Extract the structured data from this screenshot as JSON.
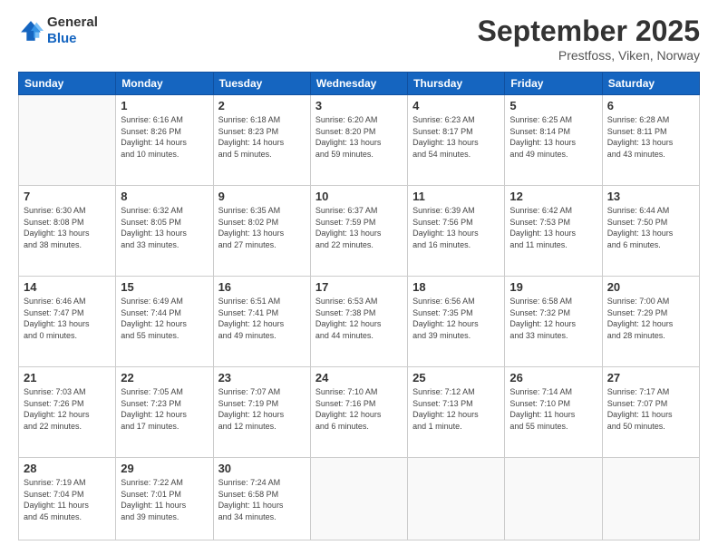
{
  "header": {
    "logo_line1": "General",
    "logo_line2": "Blue",
    "month": "September 2025",
    "location": "Prestfoss, Viken, Norway"
  },
  "weekdays": [
    "Sunday",
    "Monday",
    "Tuesday",
    "Wednesday",
    "Thursday",
    "Friday",
    "Saturday"
  ],
  "weeks": [
    [
      {
        "day": "",
        "info": ""
      },
      {
        "day": "1",
        "info": "Sunrise: 6:16 AM\nSunset: 8:26 PM\nDaylight: 14 hours\nand 10 minutes."
      },
      {
        "day": "2",
        "info": "Sunrise: 6:18 AM\nSunset: 8:23 PM\nDaylight: 14 hours\nand 5 minutes."
      },
      {
        "day": "3",
        "info": "Sunrise: 6:20 AM\nSunset: 8:20 PM\nDaylight: 13 hours\nand 59 minutes."
      },
      {
        "day": "4",
        "info": "Sunrise: 6:23 AM\nSunset: 8:17 PM\nDaylight: 13 hours\nand 54 minutes."
      },
      {
        "day": "5",
        "info": "Sunrise: 6:25 AM\nSunset: 8:14 PM\nDaylight: 13 hours\nand 49 minutes."
      },
      {
        "day": "6",
        "info": "Sunrise: 6:28 AM\nSunset: 8:11 PM\nDaylight: 13 hours\nand 43 minutes."
      }
    ],
    [
      {
        "day": "7",
        "info": "Sunrise: 6:30 AM\nSunset: 8:08 PM\nDaylight: 13 hours\nand 38 minutes."
      },
      {
        "day": "8",
        "info": "Sunrise: 6:32 AM\nSunset: 8:05 PM\nDaylight: 13 hours\nand 33 minutes."
      },
      {
        "day": "9",
        "info": "Sunrise: 6:35 AM\nSunset: 8:02 PM\nDaylight: 13 hours\nand 27 minutes."
      },
      {
        "day": "10",
        "info": "Sunrise: 6:37 AM\nSunset: 7:59 PM\nDaylight: 13 hours\nand 22 minutes."
      },
      {
        "day": "11",
        "info": "Sunrise: 6:39 AM\nSunset: 7:56 PM\nDaylight: 13 hours\nand 16 minutes."
      },
      {
        "day": "12",
        "info": "Sunrise: 6:42 AM\nSunset: 7:53 PM\nDaylight: 13 hours\nand 11 minutes."
      },
      {
        "day": "13",
        "info": "Sunrise: 6:44 AM\nSunset: 7:50 PM\nDaylight: 13 hours\nand 6 minutes."
      }
    ],
    [
      {
        "day": "14",
        "info": "Sunrise: 6:46 AM\nSunset: 7:47 PM\nDaylight: 13 hours\nand 0 minutes."
      },
      {
        "day": "15",
        "info": "Sunrise: 6:49 AM\nSunset: 7:44 PM\nDaylight: 12 hours\nand 55 minutes."
      },
      {
        "day": "16",
        "info": "Sunrise: 6:51 AM\nSunset: 7:41 PM\nDaylight: 12 hours\nand 49 minutes."
      },
      {
        "day": "17",
        "info": "Sunrise: 6:53 AM\nSunset: 7:38 PM\nDaylight: 12 hours\nand 44 minutes."
      },
      {
        "day": "18",
        "info": "Sunrise: 6:56 AM\nSunset: 7:35 PM\nDaylight: 12 hours\nand 39 minutes."
      },
      {
        "day": "19",
        "info": "Sunrise: 6:58 AM\nSunset: 7:32 PM\nDaylight: 12 hours\nand 33 minutes."
      },
      {
        "day": "20",
        "info": "Sunrise: 7:00 AM\nSunset: 7:29 PM\nDaylight: 12 hours\nand 28 minutes."
      }
    ],
    [
      {
        "day": "21",
        "info": "Sunrise: 7:03 AM\nSunset: 7:26 PM\nDaylight: 12 hours\nand 22 minutes."
      },
      {
        "day": "22",
        "info": "Sunrise: 7:05 AM\nSunset: 7:23 PM\nDaylight: 12 hours\nand 17 minutes."
      },
      {
        "day": "23",
        "info": "Sunrise: 7:07 AM\nSunset: 7:19 PM\nDaylight: 12 hours\nand 12 minutes."
      },
      {
        "day": "24",
        "info": "Sunrise: 7:10 AM\nSunset: 7:16 PM\nDaylight: 12 hours\nand 6 minutes."
      },
      {
        "day": "25",
        "info": "Sunrise: 7:12 AM\nSunset: 7:13 PM\nDaylight: 12 hours\nand 1 minute."
      },
      {
        "day": "26",
        "info": "Sunrise: 7:14 AM\nSunset: 7:10 PM\nDaylight: 11 hours\nand 55 minutes."
      },
      {
        "day": "27",
        "info": "Sunrise: 7:17 AM\nSunset: 7:07 PM\nDaylight: 11 hours\nand 50 minutes."
      }
    ],
    [
      {
        "day": "28",
        "info": "Sunrise: 7:19 AM\nSunset: 7:04 PM\nDaylight: 11 hours\nand 45 minutes."
      },
      {
        "day": "29",
        "info": "Sunrise: 7:22 AM\nSunset: 7:01 PM\nDaylight: 11 hours\nand 39 minutes."
      },
      {
        "day": "30",
        "info": "Sunrise: 7:24 AM\nSunset: 6:58 PM\nDaylight: 11 hours\nand 34 minutes."
      },
      {
        "day": "",
        "info": ""
      },
      {
        "day": "",
        "info": ""
      },
      {
        "day": "",
        "info": ""
      },
      {
        "day": "",
        "info": ""
      }
    ]
  ]
}
